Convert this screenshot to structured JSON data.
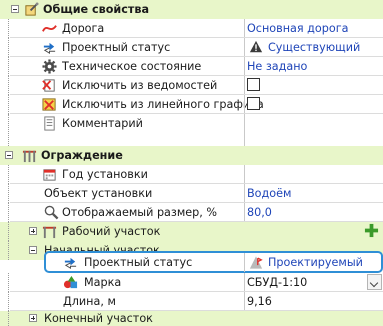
{
  "categories": {
    "general": {
      "title": "Общие свойства"
    },
    "fence": {
      "title": "Ограждение"
    }
  },
  "general_rows": [
    {
      "name": "Дорога",
      "value": "Основная дорога",
      "icon": "road-curve-icon"
    },
    {
      "name": "Проектный статус",
      "value": "Существующий",
      "icon": "status-arrows-icon",
      "value_icon": "warning-triangle-icon"
    },
    {
      "name": "Техническое состояние",
      "value": "Не задано",
      "icon": "gear-icon"
    },
    {
      "name": "Исключить из ведомостей",
      "value": "",
      "icon": "exclude-list-icon",
      "checkbox": true
    },
    {
      "name": "Исключить из линейного графика",
      "value": "",
      "icon": "exclude-chart-icon",
      "checkbox": true
    },
    {
      "name": "Комментарий",
      "value": "",
      "icon": "comment-icon"
    }
  ],
  "fence_rows": [
    {
      "name": "Год установки",
      "value": "",
      "icon": "calendar-icon"
    },
    {
      "name": "Объект установки",
      "value": "Водоём"
    },
    {
      "name": "Отображаемый размер, %",
      "value": "80,0",
      "icon": "magnifier-icon"
    }
  ],
  "work_section": {
    "title": "Рабочий участок",
    "icon": "fence-small-icon",
    "add_icon": "plus-icon"
  },
  "start_section": {
    "title": "Начальный участок",
    "rows": [
      {
        "name": "Проектный статус",
        "value": "Проектируемый",
        "icon": "status-arrows-icon",
        "value_icon": "design-status-icon"
      },
      {
        "name": "Марка",
        "value": "СБУД-1:10",
        "icon": "shapes-icon"
      },
      {
        "name": "Длина, м",
        "value": "9,16"
      }
    ]
  },
  "end_section": {
    "title": "Конечный участок"
  },
  "colors": {
    "category_bg": "#e8f6c9",
    "value_blue": "#1f45b8",
    "highlight_border": "#2f8fd6"
  }
}
